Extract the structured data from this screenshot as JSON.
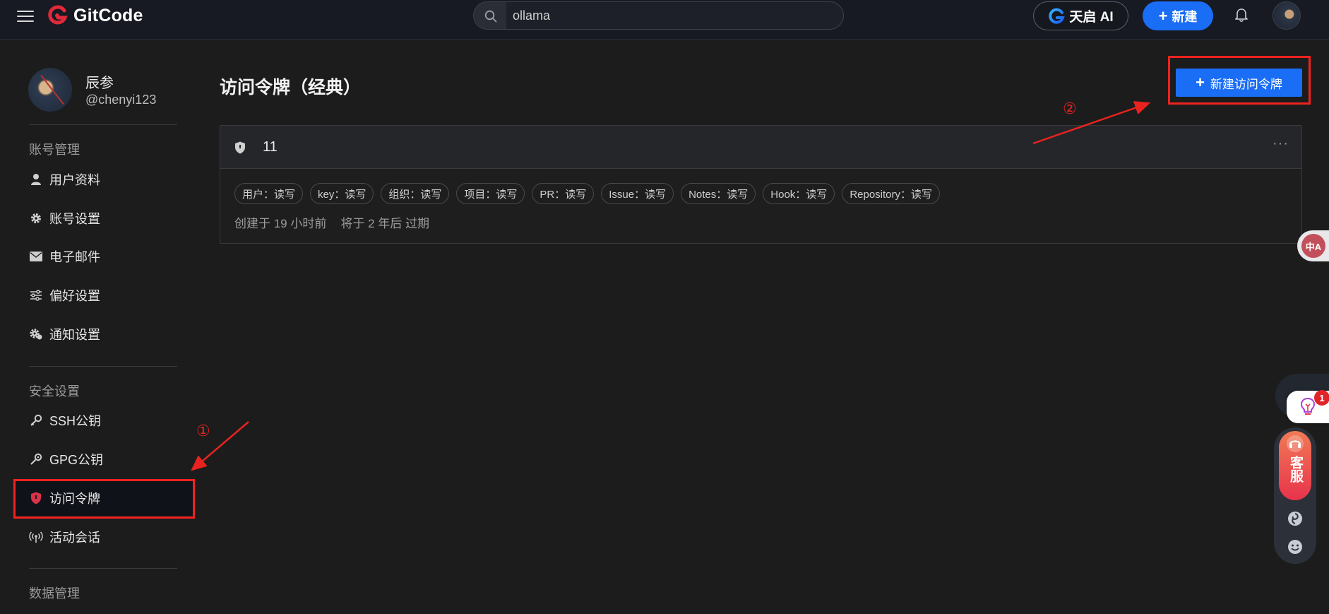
{
  "topbar": {
    "brand": "GitCode",
    "search_value": "ollama",
    "ai_label": "天启 AI",
    "new_label": "新建"
  },
  "profile": {
    "name": "辰参",
    "handle": "@chenyi123"
  },
  "sidebar": {
    "account_section": "账号管理",
    "account_items": [
      {
        "label": "用户资料",
        "icon": "user-icon"
      },
      {
        "label": "账号设置",
        "icon": "gear-icon"
      },
      {
        "label": "电子邮件",
        "icon": "mail-icon"
      },
      {
        "label": "偏好设置",
        "icon": "sliders-icon"
      },
      {
        "label": "通知设置",
        "icon": "notification-gear-icon"
      }
    ],
    "security_section": "安全设置",
    "security_items": [
      {
        "label": "SSH公钥",
        "icon": "key-icon"
      },
      {
        "label": "GPG公钥",
        "icon": "wrench-key-icon"
      },
      {
        "label": "访问令牌",
        "icon": "shield-icon",
        "active": true
      },
      {
        "label": "活动会话",
        "icon": "broadcast-icon"
      }
    ],
    "data_section": "数据管理"
  },
  "main": {
    "title": "访问令牌（经典）",
    "create_label": "新建访问令牌",
    "token": {
      "name": "11",
      "scopes": [
        "用户：读写",
        "key：读写",
        "组织：读写",
        "项目：读写",
        "PR：读写",
        "Issue：读写",
        "Notes：读写",
        "Hook：读写",
        "Repository：读写"
      ],
      "created": "创建于 19 小时前",
      "expires": "将于 2 年后 过期"
    }
  },
  "annotations": {
    "step1": "①",
    "step2": "②",
    "color": "#e8231f"
  },
  "widgets": {
    "translate_label": "中A",
    "bulb_count": "1",
    "service_label": "客服"
  },
  "colors": {
    "accent": "#1a6df5",
    "brand_red": "#e02a3a",
    "highlight": "#f0221f"
  }
}
